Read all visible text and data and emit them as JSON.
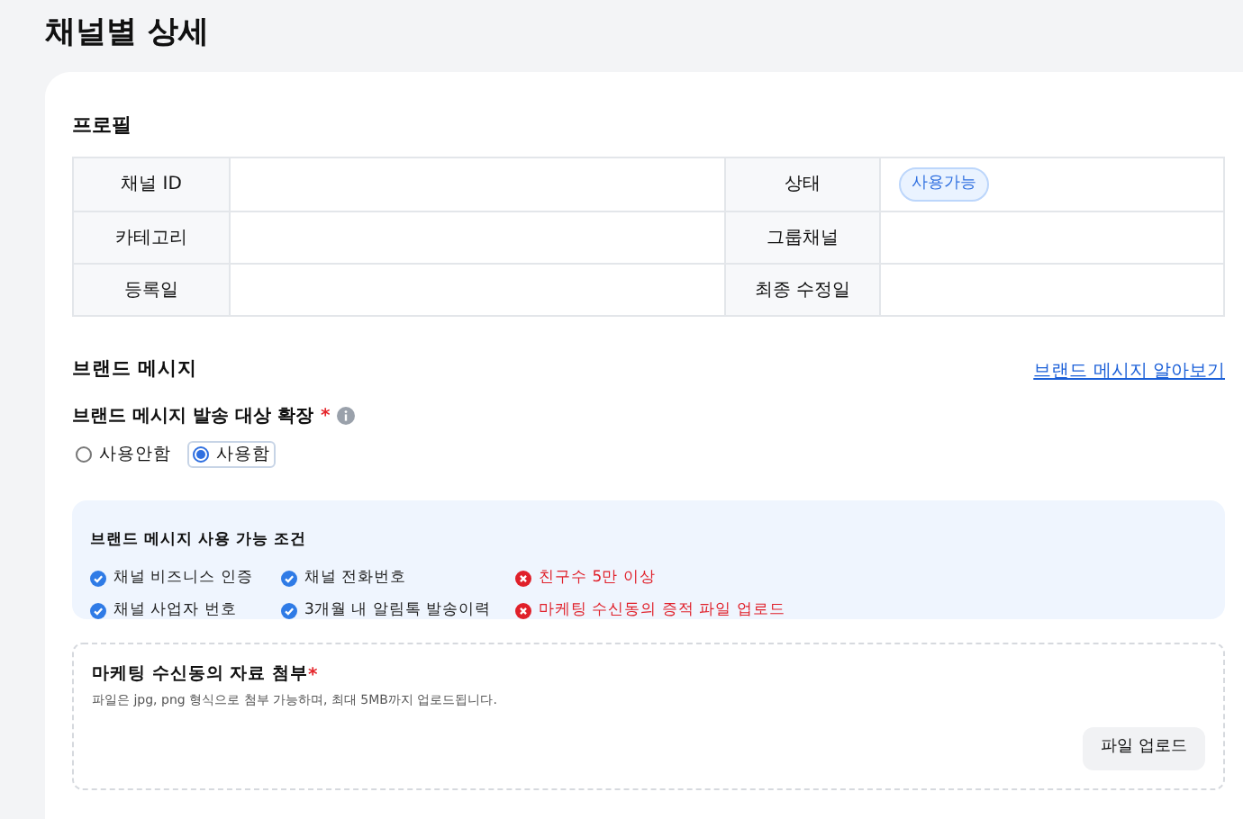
{
  "page_title": "채널별 상세",
  "profile": {
    "title": "프로필",
    "rows": [
      {
        "label_1": "채널 ID",
        "label_2": "상태",
        "status_badge": "사용가능"
      },
      {
        "label_1": "카테고리",
        "label_2": "그룹채널"
      },
      {
        "label_1": "등록일",
        "label_2": "최종 수정일"
      }
    ]
  },
  "brand_message": {
    "title": "브랜드 메시지",
    "link": "브랜드 메시지 알아보기",
    "expand_field": {
      "label": "브랜드 메시지 발송 대상 확장",
      "required_mark": "*",
      "options": [
        {
          "label": "사용안함",
          "selected": false
        },
        {
          "label": "사용함",
          "selected": true
        }
      ]
    },
    "conditions": {
      "title": "브랜드 메시지 사용 가능 조건",
      "items": [
        {
          "label": "채널 비즈니스 인증",
          "met": true
        },
        {
          "label": "채널 전화번호",
          "met": true
        },
        {
          "label": "친구수 5만 이상",
          "met": false
        },
        {
          "label": "채널 사업자 번호",
          "met": true
        },
        {
          "label": "3개월 내 알림톡 발송이력",
          "met": true
        },
        {
          "label": "마케팅 수신동의 증적 파일 업로드",
          "met": false
        }
      ]
    },
    "upload": {
      "title": "마케팅 수신동의 자료 첨부",
      "required_mark": "*",
      "hint": "파일은 jpg, png 형식으로 첨부 가능하며, 최대 5MB까지 업로드됩니다.",
      "button": "파일 업로드"
    }
  }
}
